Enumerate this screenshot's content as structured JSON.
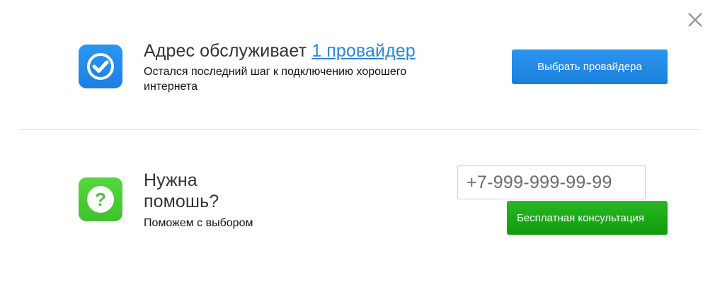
{
  "dialog": {
    "close_icon": "close-icon"
  },
  "top": {
    "icon": "checkmark-icon",
    "title_prefix": "Адрес обслуживает",
    "title_link": "1 провайдер",
    "subtitle": "Остался последний шаг к подключению хорошего интернета",
    "button_label": "Выбрать провайдера"
  },
  "bottom": {
    "icon": "question-icon",
    "title": "Нужна помошь?",
    "subtitle": "Поможем с выбором",
    "phone_placeholder": "+7-999-999-99-99",
    "button_label": "Бесплатная консультация"
  },
  "colors": {
    "blue_accent": "#1b7fe3",
    "green_accent": "#3fc22c",
    "link": "#2a86db"
  }
}
